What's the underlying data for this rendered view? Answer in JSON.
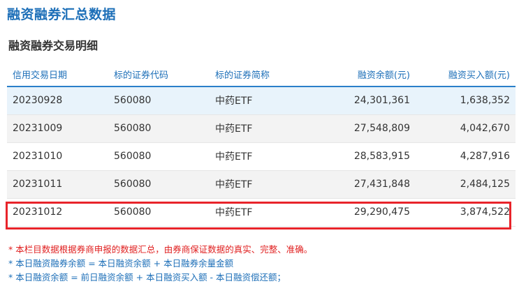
{
  "page_title": "融资融券汇总数据",
  "section_title": "融资融券交易明细",
  "table": {
    "headers": [
      "信用交易日期",
      "标的证券代码",
      "标的证券简称",
      "融资余额(元)",
      "融资买入额(元)"
    ],
    "rows": [
      [
        "20230928",
        "560080",
        "中药ETF",
        "24,301,361",
        "1,638,352"
      ],
      [
        "20231009",
        "560080",
        "中药ETF",
        "27,548,809",
        "4,042,670"
      ],
      [
        "20231010",
        "560080",
        "中药ETF",
        "28,583,915",
        "4,287,916"
      ],
      [
        "20231011",
        "560080",
        "中药ETF",
        "27,431,848",
        "2,484,125"
      ],
      [
        "20231012",
        "560080",
        "中药ETF",
        "29,290,475",
        "3,874,522"
      ]
    ]
  },
  "notes": [
    "* 本栏目数据根据券商申报的数据汇总，由券商保证数据的真实、完整、准确。",
    "* 本日融资融券余额 = 本日融资余额 + 本日融券余量金额",
    "* 本日融资余额 = 前日融资余额 + 本日融资买入额 - 本日融资偿还额；"
  ],
  "colors": {
    "accent_blue": "#1d6fb8",
    "highlight_red": "#e8242a",
    "note_red": "#e02020"
  }
}
